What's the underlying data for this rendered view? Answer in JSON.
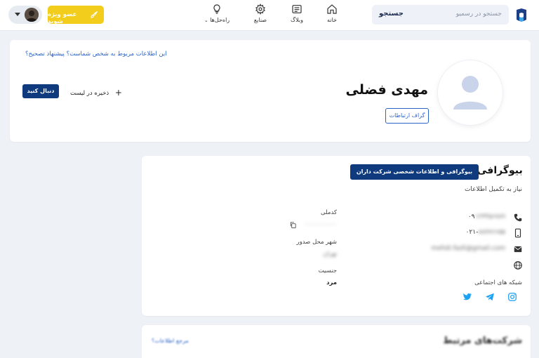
{
  "header": {
    "search_label": "جستجو",
    "search_placeholder": "جستجو در رسمیو",
    "nav": [
      {
        "label": "خانه",
        "icon": "home-icon"
      },
      {
        "label": "وبلاگ",
        "icon": "blog-icon"
      },
      {
        "label": "صنایع",
        "icon": "gear-icon"
      },
      {
        "label": "راه‌حل‌ها",
        "icon": "lightbulb-icon"
      }
    ],
    "vip_label": "عضو ویژه شوید",
    "vip_color": "#f2cd1c"
  },
  "profile": {
    "name": "مهدی فضلی",
    "graph_button": "گراف ارتباطات",
    "suggest_text": "این اطلاعات مربوط به شخص شماست؟",
    "suggest_link": "پیشنهاد تصحیح؟",
    "follow_button": "دنبال کنید",
    "save_list": "ذخیره در لیست"
  },
  "bio": {
    "title": "بیوگرافی",
    "bio_button": "بیوگرافی و اطلاعات شخصی شرکت داران",
    "need_info": "نیاز به تکمیل اطلاعات",
    "phone_prefix": "۰۹",
    "phone_hidden": "۱۲۳۴۵۶۷۸۹",
    "mobile_prefix": "۰۲۱-",
    "mobile_hidden": "۸۸۷۷۶۶۵۵",
    "email_hidden": "mehdi.fazli@gmail.com",
    "social_label": "شبکه های اجتماعی",
    "national_id_label": "کدملی",
    "national_id_hidden": "۰۰۰۰۰۰۰۰۰۰",
    "city_label": "شهر محل صدور",
    "city_hidden": "تهران",
    "gender_label": "جنسیت",
    "gender_value": "مرد"
  },
  "related": {
    "title": "شرکت‌های مرتبط",
    "ref": "مرجع اطلاعات؟"
  },
  "colors": {
    "brand_dark": "#0f3a7d",
    "link_blue": "#2a63c9",
    "twitter": "#1da1f2"
  }
}
